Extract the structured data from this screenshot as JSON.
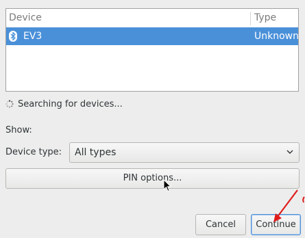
{
  "device_list": {
    "columns": {
      "device": "Device",
      "type": "Type"
    },
    "rows": [
      {
        "name": "EV3",
        "type": "Unknown",
        "icon": "bluetooth-icon",
        "selected": true
      }
    ]
  },
  "status": {
    "text": "Searching for devices...",
    "icon": "spinner-icon"
  },
  "filters": {
    "show_label": "Show:",
    "device_type_label": "Device type:",
    "device_type_value": "All types"
  },
  "buttons": {
    "pin_options": "PIN options...",
    "cancel": "Cancel",
    "continue": "Continue"
  },
  "colors": {
    "selection": "#4a90d9",
    "window_bg": "#ededed",
    "annotation_arrow": "#e01b1b"
  }
}
